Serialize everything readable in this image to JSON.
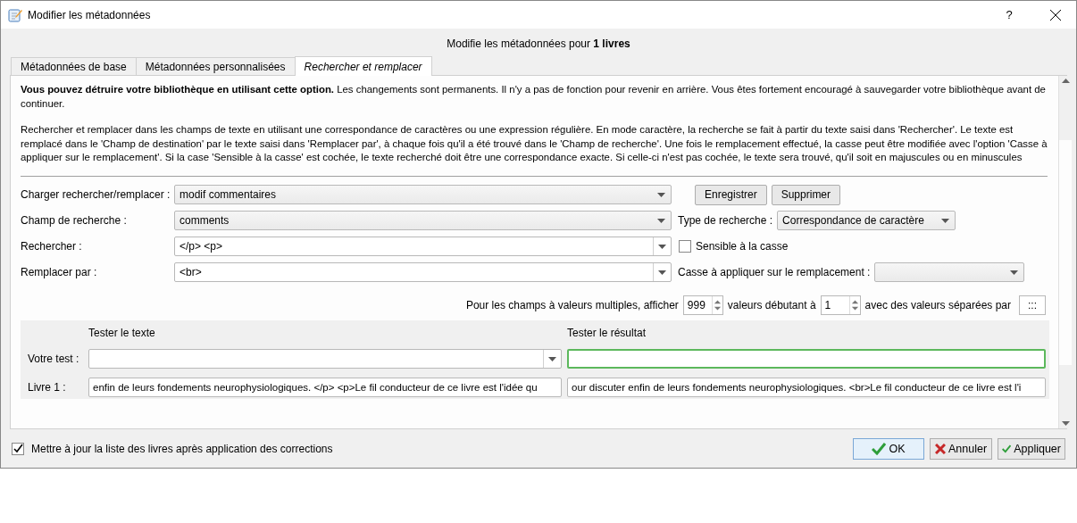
{
  "window": {
    "title": "Modifier les métadonnées",
    "help": "?"
  },
  "header": "Modifie les métadonnées pour **1 livres**",
  "tabs": [
    {
      "label": "Métadonnées de base",
      "selected": false
    },
    {
      "label": "Métadonnées personnalisées",
      "selected": false
    },
    {
      "label": "Rechercher et remplacer",
      "selected": true
    }
  ],
  "warning": "**Vous pouvez détruire votre bibliothèque en utilisant cette option.** Les changements sont permanents. Il n'y a pas de fonction pour revenir en arrière. Vous êtes fortement encouragé à sauvegarder votre bibliothèque avant de continuer.",
  "description": "Rechercher et remplacer dans les champs de texte en utilisant une correspondance de caractères ou une expression régulière. En mode caractère, la recherche se fait à partir du texte saisi dans 'Rechercher'. Le texte est remplacé dans le 'Champ de destination' par le texte saisi dans 'Remplacer par', à chaque fois qu'il a été trouvé dans le 'Champ de recherche'. Une fois le remplacement effectué, la casse peut être modifiée avec l'option 'Casse à appliquer sur le remplacement'. Si la case 'Sensible à la casse' est cochée, le texte recherché doit être une correspondance exacte. Si celle-ci n'est pas cochée, le texte sera trouvé, qu'il soit en majuscules ou en minuscules",
  "form": {
    "load": {
      "label": "Charger rechercher/remplacer :",
      "value": "modif commentaires",
      "editable": false
    },
    "load_buttons": [
      "Enregistrer",
      "Supprimer"
    ],
    "field": {
      "label": "Champ de recherche :",
      "value": "comments",
      "editable": false
    },
    "search_type": {
      "label": "Type de recherche :",
      "value": "Correspondance de caractère",
      "editable": false
    },
    "find": {
      "label": "Rechercher :",
      "value": "</p> <p>",
      "editable": true
    },
    "case_sensitive": {
      "label": "Sensible à la casse",
      "checked": false
    },
    "replace": {
      "label": "Remplacer par :",
      "value": "<br>",
      "editable": true
    },
    "case_apply": {
      "label": "Casse à appliquer sur le remplacement :",
      "editable": false
    }
  },
  "multi": {
    "show_label": "Pour les champs à valeurs multiples, afficher",
    "count": "999",
    "start_label": "valeurs débutant à",
    "start": "1",
    "separator_label": "avec des valeurs séparées par",
    "separator": ":::"
  },
  "test": {
    "text_heading": "Tester le texte",
    "result_heading": "Tester le résultat",
    "your_test": {
      "label": "Votre test :",
      "editable": true
    },
    "book": {
      "label": "Livre 1 :",
      "value": "enfin de leurs fondements neurophysiologiques. </p> <p>Le fil conducteur de ce livre est l'idée qu",
      "result": "our discuter enfin de leurs fondements neurophysiologiques. <br>Le fil conducteur de ce livre est l'i"
    }
  },
  "footer": {
    "update_list": {
      "label": "Mettre à jour la liste des livres après application des corrections",
      "checked": true
    },
    "buttons": [
      {
        "label": "OK",
        "kind": "ok"
      },
      {
        "label": "Annuler",
        "kind": "cancel"
      },
      {
        "label": "Appliquer",
        "kind": "apply"
      }
    ]
  }
}
